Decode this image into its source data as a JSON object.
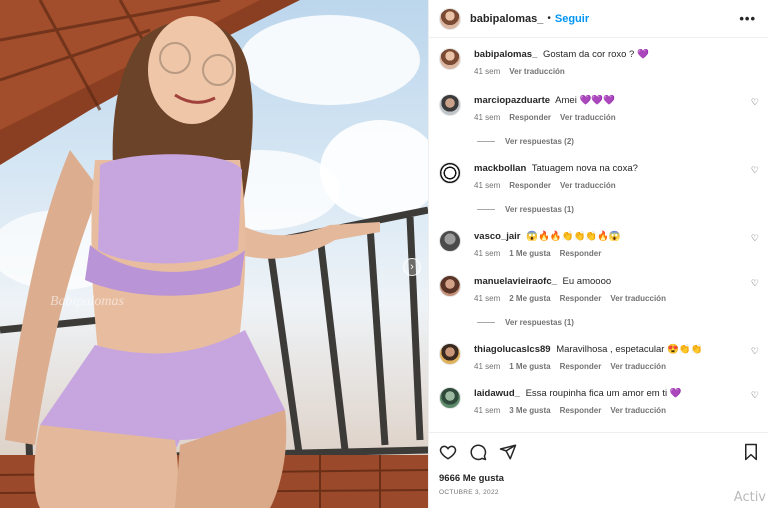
{
  "post": {
    "username": "babipalomas_",
    "separator": "•",
    "follow_label": "Seguir",
    "more_label": "•••",
    "photo_watermark": "Babipalomas"
  },
  "comments": [
    {
      "username": "babipalomas_",
      "text": "Gostam da cor roxo ?",
      "emoji": "💜",
      "time": "41 sem",
      "actions": [
        "Ver traducción"
      ],
      "has_heart": false
    },
    {
      "username": "marciopazduarte",
      "text": "Amei",
      "emoji": "💜💜💜",
      "time": "41 sem",
      "actions": [
        "Responder",
        "Ver traducción"
      ],
      "has_heart": true,
      "replies": "Ver respuestas (2)"
    },
    {
      "username": "mackbollan",
      "text": "Tatuagem nova na coxa?",
      "emoji": "",
      "time": "41 sem",
      "actions": [
        "Responder",
        "Ver traducción"
      ],
      "has_heart": true,
      "replies": "Ver respuestas (1)"
    },
    {
      "username": "vasco_jair",
      "text": "",
      "emoji": "😱🔥🔥👏👏👏🔥😱",
      "time": "41 sem",
      "likes": "1 Me gusta",
      "actions": [
        "Responder"
      ],
      "has_heart": true
    },
    {
      "username": "manuelavieiraofc_",
      "text": "Eu amoooo",
      "emoji": "",
      "time": "41 sem",
      "likes": "2 Me gusta",
      "actions": [
        "Responder",
        "Ver traducción"
      ],
      "has_heart": true,
      "replies": "Ver respuestas (1)"
    },
    {
      "username": "thiagolucaslcs89",
      "text": "Maravilhosa , espetacular",
      "emoji": "😍👏👏",
      "time": "41 sem",
      "likes": "1 Me gusta",
      "actions": [
        "Responder",
        "Ver traducción"
      ],
      "has_heart": true
    },
    {
      "username": "laidawud_",
      "text": "Essa roupinha fica um amor em ti",
      "emoji": "💜",
      "time": "41 sem",
      "likes": "3 Me gusta",
      "actions": [
        "Responder",
        "Ver traducción"
      ],
      "has_heart": true
    }
  ],
  "footer": {
    "likes": "9666 Me gusta",
    "date": "OCTUBRE 3, 2022"
  },
  "overlay": {
    "watermark": "Activ"
  },
  "icons": {
    "like": "heart-icon",
    "comment": "comment-icon",
    "share": "share-icon",
    "save": "bookmark-icon",
    "carousel_next": "chevron-right-icon"
  },
  "colors": {
    "link_blue": "#0095f6",
    "secondary_text": "#737373",
    "outfit_lilac": "#c7a6df"
  }
}
